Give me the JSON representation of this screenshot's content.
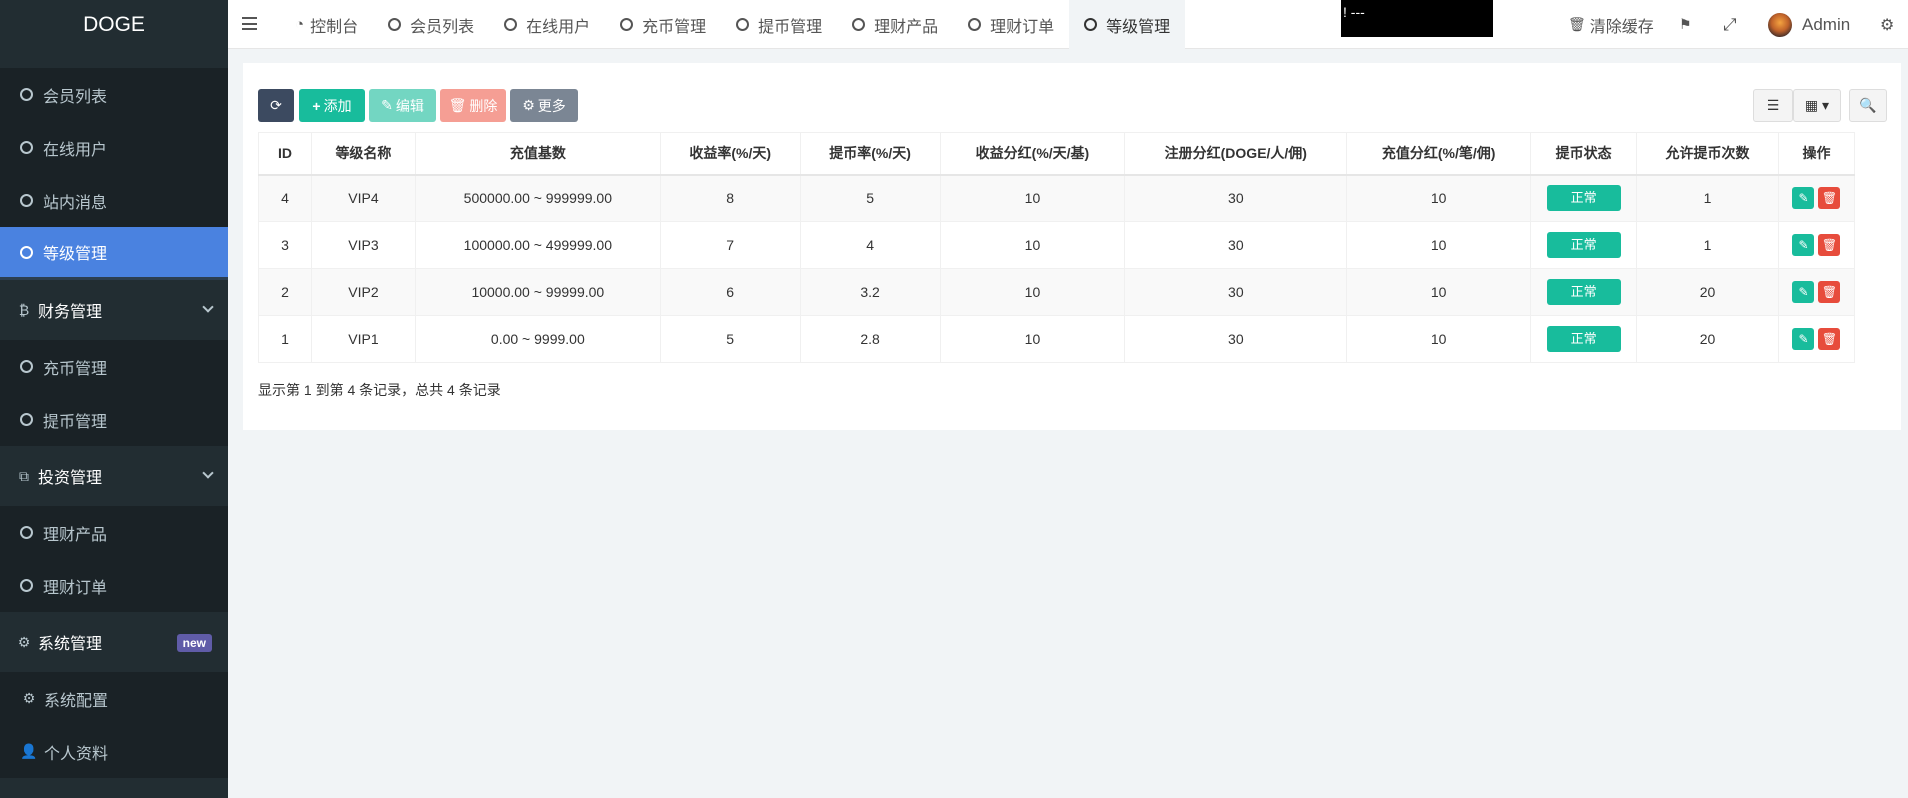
{
  "sidebar": {
    "logo": "DOGE",
    "items": [
      {
        "label": "会员列表",
        "type": "sub"
      },
      {
        "label": "在线用户",
        "type": "sub"
      },
      {
        "label": "站内消息",
        "type": "sub"
      },
      {
        "label": "等级管理",
        "type": "sub",
        "active": true
      },
      {
        "label": "财务管理",
        "type": "header",
        "icon": "bitcoin-icon"
      },
      {
        "label": "充币管理",
        "type": "sub"
      },
      {
        "label": "提币管理",
        "type": "sub"
      },
      {
        "label": "投资管理",
        "type": "header",
        "icon": "cubes-icon"
      },
      {
        "label": "理财产品",
        "type": "sub"
      },
      {
        "label": "理财订单",
        "type": "sub"
      },
      {
        "label": "系统管理",
        "type": "header",
        "icon": "gears-icon",
        "badge": "new"
      },
      {
        "label": "系统配置",
        "type": "sub",
        "icon": "gear-icon"
      },
      {
        "label": "个人资料",
        "type": "sub",
        "icon": "user-icon"
      }
    ]
  },
  "topbar": {
    "tabs": [
      "控制台",
      "会员列表",
      "在线用户",
      "充币管理",
      "提币管理",
      "理财产品",
      "理财订单",
      "等级管理"
    ],
    "blackbox": "! ---",
    "clear_cache": "清除缓存",
    "user": "Admin"
  },
  "toolbar": {
    "add": "添加",
    "edit": "编辑",
    "delete": "删除",
    "more": "更多"
  },
  "table": {
    "headers": [
      "ID",
      "等级名称",
      "充值基数",
      "收益率(%/天)",
      "提币率(%/天)",
      "收益分红(%/天/基)",
      "注册分红(DOGE/人/佣)",
      "充值分红(%/笔/佣)",
      "提币状态",
      "允许提币次数",
      "操作"
    ],
    "rows": [
      [
        "4",
        "VIP4",
        "500000.00 ~ 999999.00",
        "8",
        "5",
        "10",
        "30",
        "10",
        "正常",
        "1"
      ],
      [
        "3",
        "VIP3",
        "100000.00 ~ 499999.00",
        "7",
        "4",
        "10",
        "30",
        "10",
        "正常",
        "1"
      ],
      [
        "2",
        "VIP2",
        "10000.00 ~ 99999.00",
        "6",
        "3.2",
        "10",
        "30",
        "10",
        "正常",
        "20"
      ],
      [
        "1",
        "VIP1",
        "0.00 ~ 9999.00",
        "5",
        "2.8",
        "10",
        "30",
        "10",
        "正常",
        "20"
      ]
    ]
  },
  "footer": {
    "summary": "显示第 1 到第 4 条记录，总共 4 条记录"
  },
  "colors": {
    "sidebar_bg": "#222d32",
    "active_item": "#4a82e0",
    "primary": "#18bc9c",
    "danger": "#e74c3c"
  }
}
